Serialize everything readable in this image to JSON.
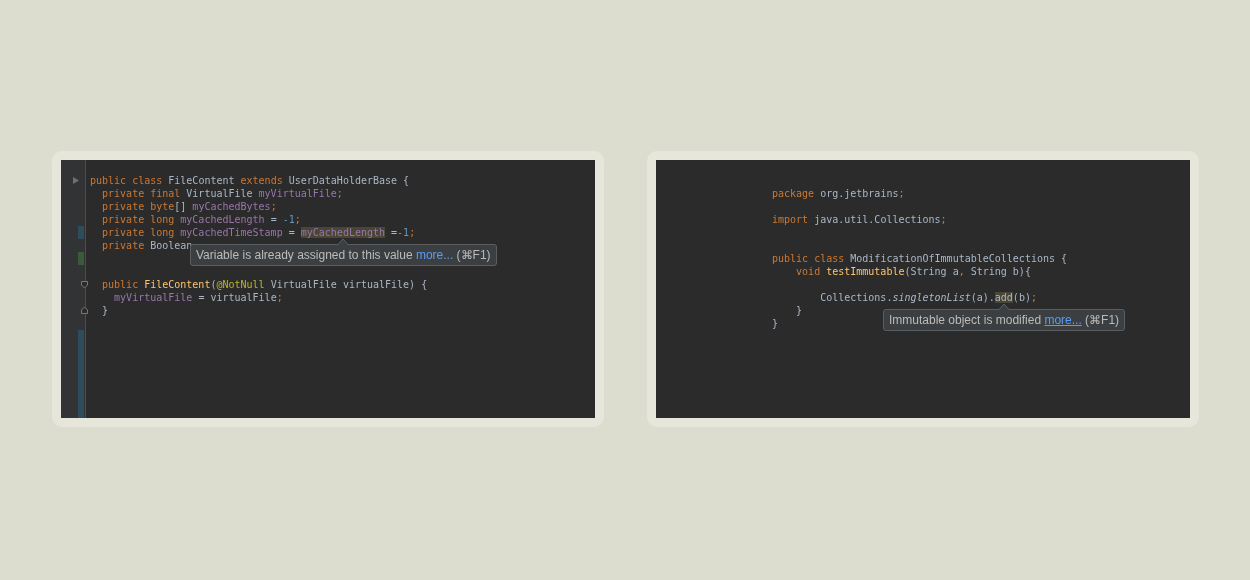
{
  "panels": [
    {
      "gutter": true,
      "lines": [
        {
          "kind": "code",
          "fold": {
            "kind": "arrow"
          },
          "tokens": [
            {
              "text": "public class ",
              "kind": "keyword"
            },
            {
              "text": "FileContent ",
              "kind": "plain"
            },
            {
              "text": "extends ",
              "kind": "keyword"
            },
            {
              "text": "UserDataHolderBase {",
              "kind": "plain"
            }
          ]
        },
        {
          "kind": "code",
          "tokens": [
            {
              "text": "  private final ",
              "kind": "keyword"
            },
            {
              "text": "VirtualFile ",
              "kind": "plain"
            },
            {
              "text": "myVirtualFile",
              "kind": "field"
            },
            {
              "text": ";",
              "kind": "keyword"
            }
          ]
        },
        {
          "kind": "code",
          "tokens": [
            {
              "text": "  private byte",
              "kind": "keyword"
            },
            {
              "text": "[] ",
              "kind": "plain"
            },
            {
              "text": "myCachedBytes",
              "kind": "field"
            },
            {
              "text": ";",
              "kind": "keyword"
            }
          ]
        },
        {
          "kind": "code",
          "tokens": [
            {
              "text": "  private long ",
              "kind": "keyword"
            },
            {
              "text": "myCachedLength",
              "kind": "field"
            },
            {
              "text": " = ",
              "kind": "plain"
            },
            {
              "text": "-1",
              "kind": "number"
            },
            {
              "text": ";",
              "kind": "keyword"
            }
          ]
        },
        {
          "kind": "code",
          "change": {
            "color": "#2f4c5c"
          },
          "tokens": [
            {
              "text": "  private long ",
              "kind": "keyword"
            },
            {
              "text": "myCachedTimeStamp",
              "kind": "field"
            },
            {
              "text": " = ",
              "kind": "plain"
            },
            {
              "text": "myCachedLength",
              "kind": "field",
              "highlighted": true
            },
            {
              "text": " =",
              "kind": "plain"
            },
            {
              "text": "-1",
              "kind": "number"
            },
            {
              "text": ";",
              "kind": "keyword"
            }
          ]
        },
        {
          "kind": "code",
          "tokens": [
            {
              "text": "  private ",
              "kind": "keyword"
            },
            {
              "text": "Boolean",
              "kind": "plain"
            }
          ]
        },
        {
          "kind": "blank",
          "change": {
            "color": "#3a5a3a"
          }
        },
        {
          "kind": "blank"
        },
        {
          "kind": "code",
          "fold": {
            "kind": "start"
          },
          "tokens": [
            {
              "text": "  public ",
              "kind": "keyword"
            },
            {
              "text": "FileContent",
              "kind": "method"
            },
            {
              "text": "(",
              "kind": "plain"
            },
            {
              "text": "@NotNull",
              "kind": "annotation"
            },
            {
              "text": " VirtualFile virtualFile) {",
              "kind": "plain"
            }
          ]
        },
        {
          "kind": "code",
          "tokens": [
            {
              "text": "    myVirtualFile",
              "kind": "field"
            },
            {
              "text": " = virtualFile",
              "kind": "plain"
            },
            {
              "text": ";",
              "kind": "keyword"
            }
          ]
        },
        {
          "kind": "code",
          "fold": {
            "kind": "end"
          },
          "tokens": [
            {
              "text": "  }",
              "kind": "plain"
            }
          ]
        },
        {
          "kind": "blank"
        },
        {
          "kind": "blank",
          "change": {
            "color": "#2f4c5c"
          }
        },
        {
          "kind": "blank",
          "change": {
            "color": "#2f4c5c"
          }
        },
        {
          "kind": "blank",
          "change": {
            "color": "#2f4c5c"
          }
        },
        {
          "kind": "blank",
          "change": {
            "color": "#2f4c5c"
          }
        },
        {
          "kind": "blank",
          "change": {
            "color": "#2f4c5c"
          }
        },
        {
          "kind": "blank",
          "change": {
            "color": "#2f4c5c"
          }
        },
        {
          "kind": "blank",
          "change": {
            "color": "#2f4c5c"
          }
        }
      ],
      "tooltip": {
        "message": "Variable is already assigned to this value",
        "link": "more...",
        "link_underlined": false,
        "shortcut": "(⌘F1)"
      }
    },
    {
      "gutter": false,
      "lines": [
        {
          "kind": "code",
          "tokens": [
            {
              "text": "package ",
              "kind": "keyword"
            },
            {
              "text": "org.jetbrains",
              "kind": "plain"
            },
            {
              "text": ";",
              "kind": "keyword"
            }
          ]
        },
        {
          "kind": "blank"
        },
        {
          "kind": "code",
          "tokens": [
            {
              "text": "import ",
              "kind": "keyword"
            },
            {
              "text": "java.util.Collections",
              "kind": "plain"
            },
            {
              "text": ";",
              "kind": "keyword"
            }
          ]
        },
        {
          "kind": "blank"
        },
        {
          "kind": "blank"
        },
        {
          "kind": "code",
          "tokens": [
            {
              "text": "public class ",
              "kind": "keyword"
            },
            {
              "text": "ModificationOfImmutableCollections {",
              "kind": "plain"
            }
          ]
        },
        {
          "kind": "code",
          "tokens": [
            {
              "text": "    void ",
              "kind": "keyword"
            },
            {
              "text": "testImmutable",
              "kind": "method"
            },
            {
              "text": "(String a",
              "kind": "plain"
            },
            {
              "text": ", ",
              "kind": "keyword"
            },
            {
              "text": "String b){",
              "kind": "plain"
            }
          ]
        },
        {
          "kind": "blank"
        },
        {
          "kind": "code",
          "tokens": [
            {
              "text": "        Collections.",
              "kind": "plain"
            },
            {
              "text": "singletonList",
              "kind": "static-call"
            },
            {
              "text": "(a).",
              "kind": "plain"
            },
            {
              "text": "add",
              "kind": "plain",
              "highlighted": true
            },
            {
              "text": "(b)",
              "kind": "plain"
            },
            {
              "text": ";",
              "kind": "keyword"
            }
          ]
        },
        {
          "kind": "code",
          "tokens": [
            {
              "text": "    }",
              "kind": "plain"
            }
          ]
        },
        {
          "kind": "code",
          "tokens": [
            {
              "text": "}",
              "kind": "plain"
            }
          ]
        }
      ],
      "tooltip": {
        "message": "Immutable object is modified",
        "link": "more...",
        "link_underlined": true,
        "shortcut": "(⌘F1)"
      }
    }
  ]
}
